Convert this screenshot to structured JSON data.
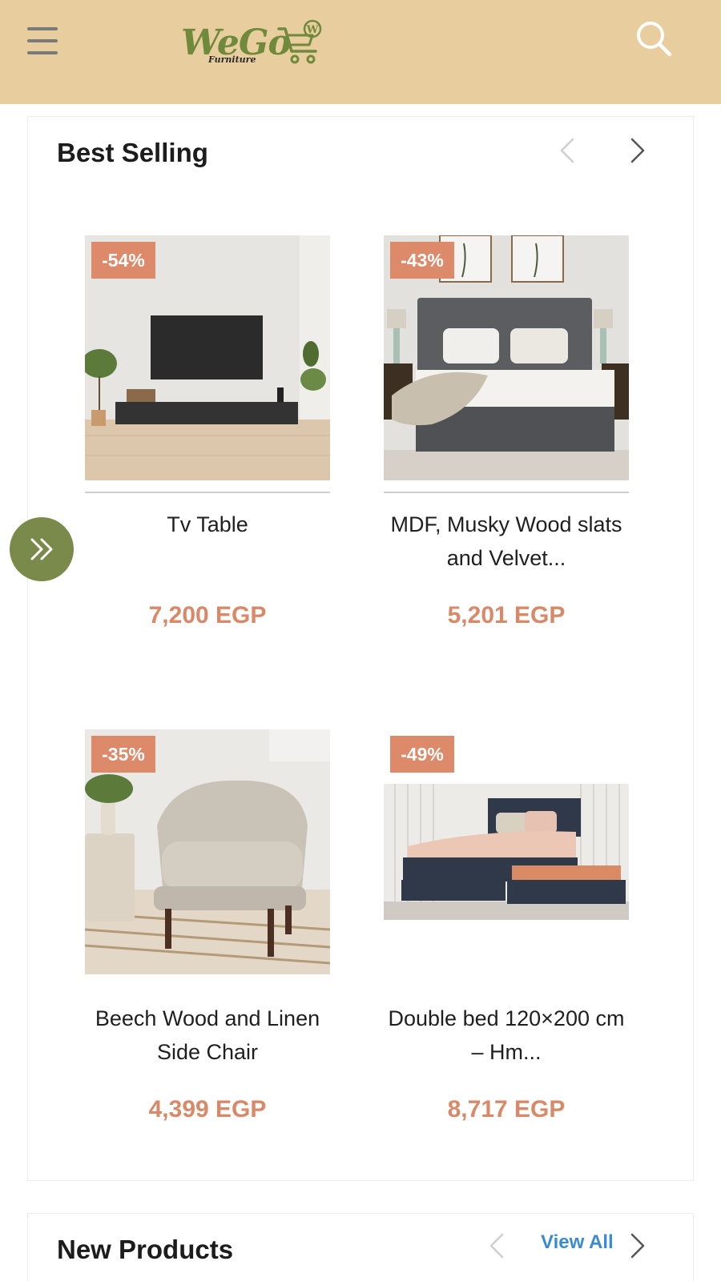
{
  "header": {
    "logo_text": "WeGo",
    "logo_subtext": "Furniture",
    "logo_cart_letter": "W",
    "menu_icon": "hamburger-menu-icon",
    "search_icon": "search-icon",
    "background_color": "#e8cd9e"
  },
  "best_selling": {
    "title": "Best Selling",
    "products": [
      {
        "name": "Tv Table",
        "price": "7,200 EGP",
        "discount": "-54%",
        "image": "tv-table-image"
      },
      {
        "name": "MDF, Musky Wood slats and Velvet...",
        "price": "5,201 EGP",
        "discount": "-43%",
        "image": "upholstered-bed-image"
      },
      {
        "name": "Beech Wood and Linen Side Chair",
        "price": "4,399 EGP",
        "discount": "-35%",
        "image": "armchair-image"
      },
      {
        "name": "Double bed 120×200 cm – Hm...",
        "price": "8,717 EGP",
        "discount": "-49%",
        "image": "trundle-bed-image"
      }
    ]
  },
  "new_products": {
    "title": "New Products",
    "view_all": "View All"
  },
  "colors": {
    "price": "#d98967",
    "badge": "#dd8a6a",
    "logo_green": "#6e8a3a",
    "quick_button": "#7a8a4a",
    "link_blue": "#3b8bd0"
  }
}
